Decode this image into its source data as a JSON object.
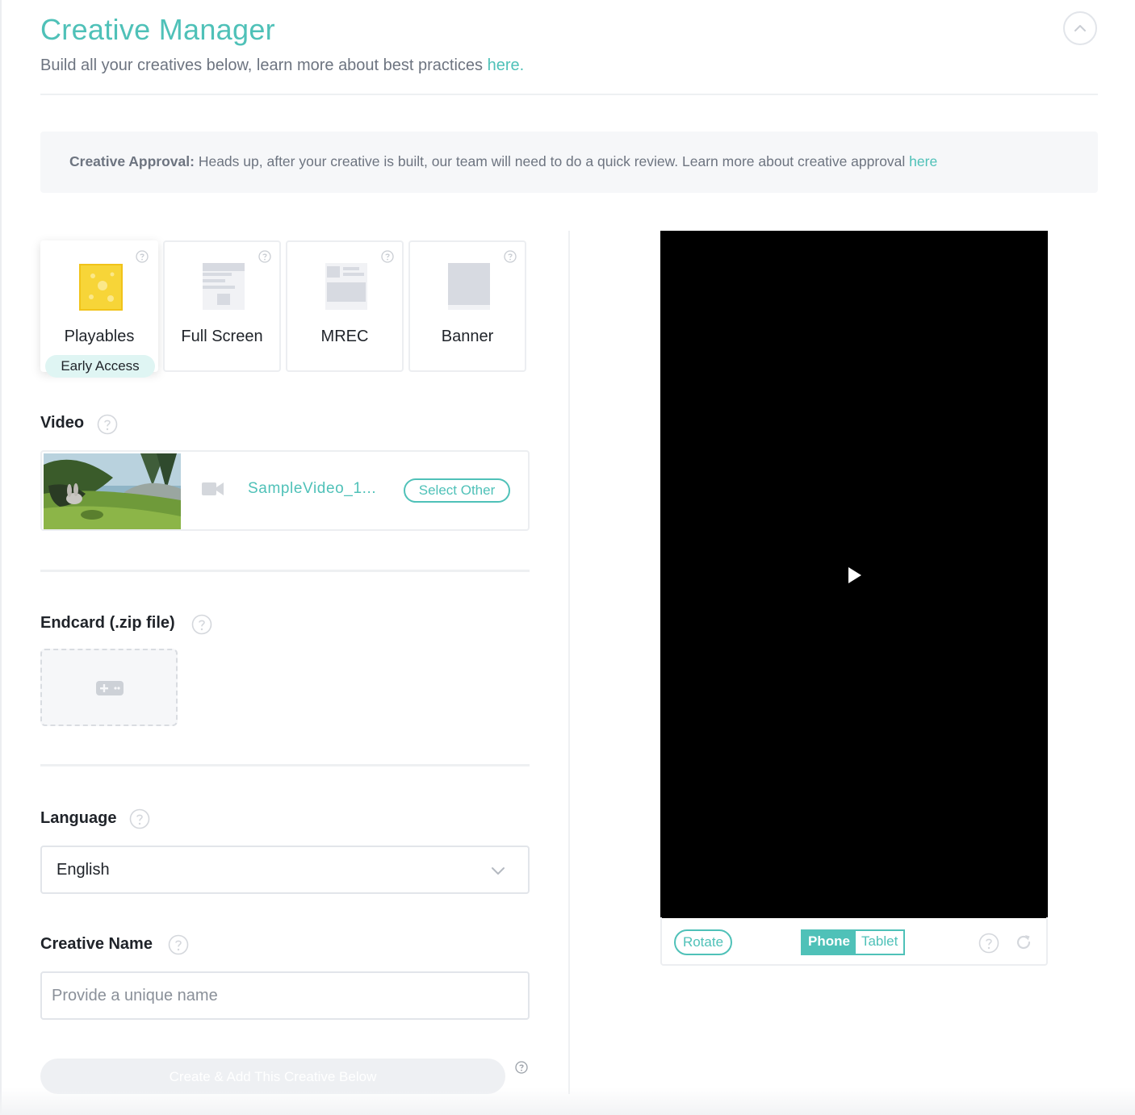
{
  "header": {
    "title": "Creative Manager",
    "subtitle": "Build all your creatives below, learn more about best practices ",
    "subtitle_link": "here."
  },
  "notice": {
    "label": "Creative Approval:",
    "text": " Heads up, after your creative is built, our team will need to do a quick review. Learn more about creative approval ",
    "link": "here"
  },
  "creative_types": [
    {
      "label": "Playables",
      "badge": "Early Access",
      "selected": true,
      "icon": "playable-icon"
    },
    {
      "label": "Full Screen",
      "selected": false,
      "icon": "full-screen-icon"
    },
    {
      "label": "MREC",
      "selected": false,
      "icon": "mrec-icon"
    },
    {
      "label": "Banner",
      "selected": false,
      "icon": "banner-icon"
    }
  ],
  "video": {
    "label": "Video",
    "file_name": "SampleVideo_1...",
    "select_other": "Select Other"
  },
  "endcard": {
    "label": "Endcard (.zip file)",
    "icon": "gamepad-icon"
  },
  "language": {
    "label": "Language",
    "value": "English"
  },
  "creative_name": {
    "label": "Creative Name",
    "placeholder": "Provide a unique name",
    "value": ""
  },
  "create_button": "Create & Add This Creative Below",
  "preview": {
    "rotate": "Rotate",
    "phone": "Phone",
    "tablet": "Tablet",
    "active_device": "Phone"
  },
  "colors": {
    "accent": "#4fc1b8",
    "playable_yellow": "#f7d538",
    "preview_bg": "#000000"
  }
}
